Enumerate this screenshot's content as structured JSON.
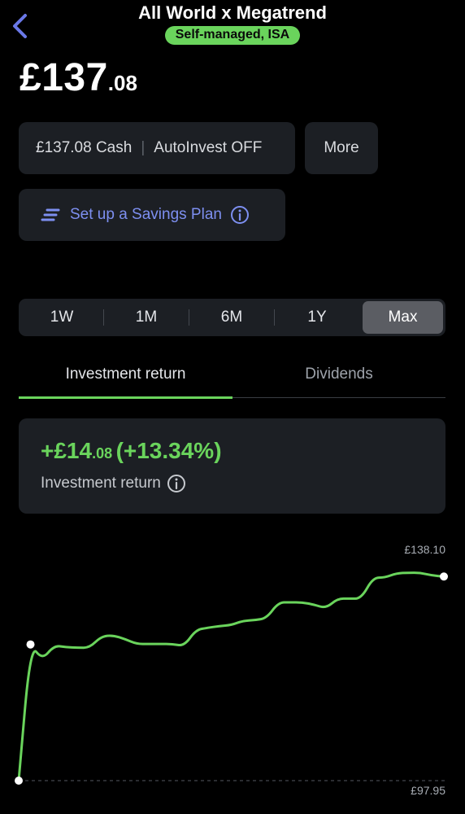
{
  "header": {
    "title": "All World x Megatrend",
    "badge": "Self-managed, ISA",
    "accent_color": "#6ad45c",
    "back_icon": "chevron-left-icon"
  },
  "balance": {
    "main": "£137",
    "decimal": ".08"
  },
  "cash_card": {
    "cash": "£137.08 Cash",
    "separator": "|",
    "autoinvest": "AutoInvest OFF"
  },
  "more_label": "More",
  "savings_plan": {
    "label": "Set up a Savings Plan",
    "icon": "list-lines-icon",
    "info_icon": "info-icon",
    "color": "#7d8ff0"
  },
  "periods": {
    "items": [
      "1W",
      "1M",
      "6M",
      "1Y",
      "Max"
    ],
    "selected": "Max"
  },
  "tabs": {
    "items": [
      "Investment return",
      "Dividends"
    ],
    "selected": "Investment return"
  },
  "return_card": {
    "value_main": "+£14",
    "value_decimal": ".08",
    "value_percent": "(+13.34%)",
    "label": "Investment return",
    "color": "#6ad45c"
  },
  "chart_data": {
    "type": "line",
    "max_label": "£138.10",
    "min_label": "£97.95",
    "ylim": [
      97.95,
      138.1
    ],
    "line_color": "#6ad45c",
    "values": [
      97.95,
      123.2,
      120.4,
      123.0,
      122.7,
      122.6,
      122.6,
      124.7,
      124.9,
      124.2,
      123.3,
      123.3,
      123.3,
      123.3,
      122.9,
      125.9,
      126.3,
      126.6,
      126.8,
      127.6,
      127.7,
      128.1,
      131.0,
      131.0,
      131.0,
      130.6,
      129.9,
      131.7,
      131.7,
      131.7,
      135.6,
      135.6,
      136.4,
      136.5,
      136.5,
      136.0,
      135.8
    ]
  }
}
